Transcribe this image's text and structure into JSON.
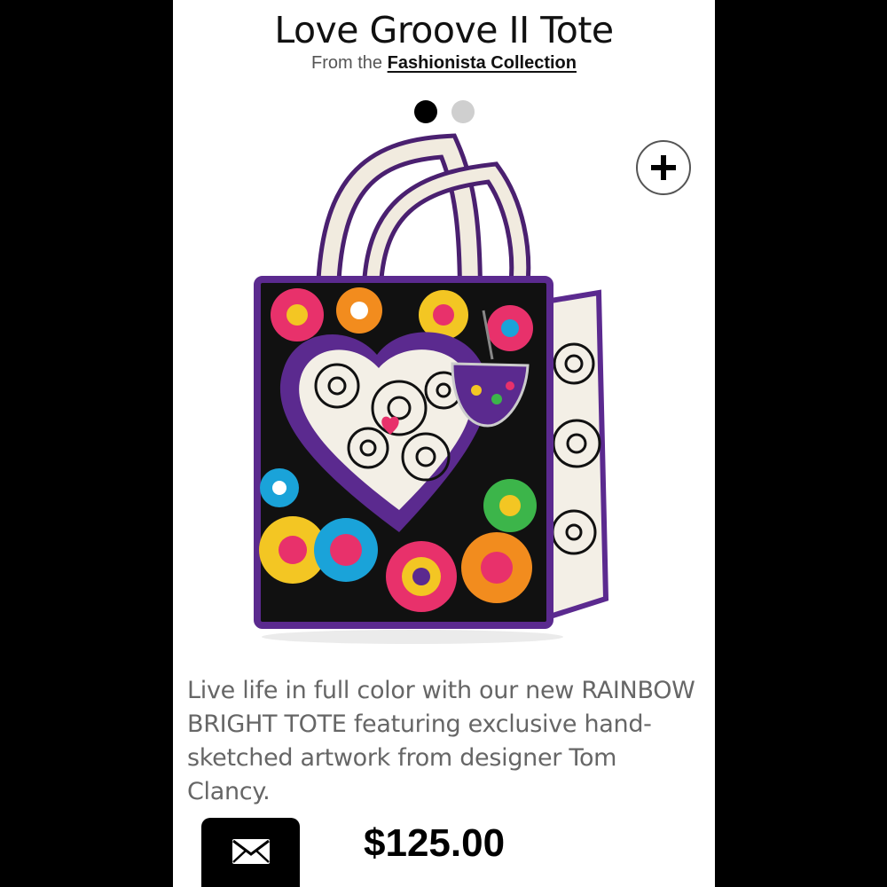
{
  "product": {
    "title": "Love Groove II Tote",
    "subtitle_prefix": "From the ",
    "collection_link": "Fashionista Collection",
    "description": "Live life in full color with our new RAINBOW BRIGHT TOTE featuring exclusive hand-sketched artwork from designer Tom Clancy.",
    "price": "$125.00"
  },
  "carousel": {
    "dot_count": 2,
    "active_index": 0
  },
  "icons": {
    "zoom": "plus-icon",
    "share": "envelope-icon"
  },
  "colors": {
    "background": "#000000",
    "panel": "#ffffff",
    "dot_active": "#000000",
    "dot_inactive": "#cfcfcf",
    "bag_trim": "#5b2a8f"
  }
}
